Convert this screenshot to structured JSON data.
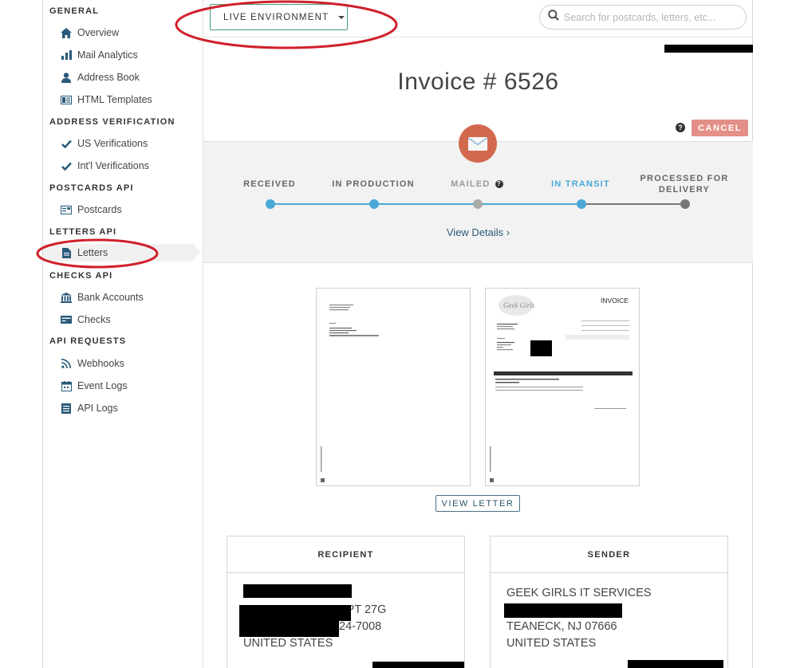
{
  "sidebar": {
    "sections": [
      {
        "title": "GENERAL",
        "items": [
          {
            "label": "Overview",
            "icon": "home-icon"
          },
          {
            "label": "Mail Analytics",
            "icon": "bar-chart-icon"
          },
          {
            "label": "Address Book",
            "icon": "person-icon"
          },
          {
            "label": "HTML Templates",
            "icon": "template-icon"
          }
        ]
      },
      {
        "title": "ADDRESS VERIFICATION",
        "items": [
          {
            "label": "US Verifications",
            "icon": "check-icon"
          },
          {
            "label": "Int'l Verifications",
            "icon": "check-icon"
          }
        ]
      },
      {
        "title": "POSTCARDS API",
        "items": [
          {
            "label": "Postcards",
            "icon": "postcard-icon"
          }
        ]
      },
      {
        "title": "LETTERS API",
        "items": [
          {
            "label": "Letters",
            "icon": "document-icon",
            "active": true
          }
        ]
      },
      {
        "title": "CHECKS API",
        "items": [
          {
            "label": "Bank Accounts",
            "icon": "bank-icon"
          },
          {
            "label": "Checks",
            "icon": "check-card-icon"
          }
        ]
      },
      {
        "title": "API REQUESTS",
        "items": [
          {
            "label": "Webhooks",
            "icon": "rss-icon"
          },
          {
            "label": "Event Logs",
            "icon": "calendar-icon"
          },
          {
            "label": "API Logs",
            "icon": "list-icon"
          }
        ]
      }
    ]
  },
  "header": {
    "environment_label": "LIVE ENVIRONMENT",
    "search_placeholder": "Search for postcards, letters, etc..."
  },
  "page": {
    "title": "Invoice # 6526",
    "cancel_label": "CANCEL"
  },
  "tracking": {
    "stages": [
      {
        "label": "RECEIVED",
        "state": "done"
      },
      {
        "label": "IN PRODUCTION",
        "state": "done"
      },
      {
        "label": "MAILED",
        "state": "skipped",
        "has_help": true
      },
      {
        "label": "IN TRANSIT",
        "state": "current"
      },
      {
        "label": "PROCESSED FOR DELIVERY",
        "state": "pending"
      }
    ],
    "view_details_label": "View Details ›"
  },
  "preview": {
    "invoice_heading": "INVOICE",
    "logo_text": "Geek Girls",
    "view_letter_label": "VIEW LETTER"
  },
  "recipient": {
    "heading": "RECIPIENT",
    "line2_visible": "APT 27G",
    "line3_visible": "24-7008",
    "country": "UNITED STATES"
  },
  "sender": {
    "heading": "SENDER",
    "name": "GEEK GIRLS IT SERVICES",
    "city_line": "TEANECK, NJ 07666",
    "country": "UNITED STATES"
  },
  "colors": {
    "accent_green": "#49a079",
    "stage_done": "#4aa8d8",
    "stage_pending": "#777777",
    "cancel": "#e38f87",
    "envelope_circle": "#d2694f"
  }
}
